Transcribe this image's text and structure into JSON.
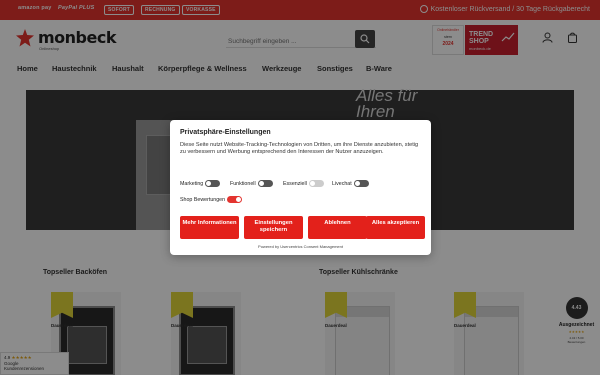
{
  "topbar": {
    "payments": [
      "amazon pay",
      "PayPal PLUS",
      "SOFORT",
      "RECHNUNG",
      "VORKASSE"
    ],
    "shipping_text": "Kostenloser Rückversand / 30 Tage Rückgaberecht"
  },
  "header": {
    "logo_text": "monbeck",
    "logo_tagline": "Onlineshop",
    "search_placeholder": "Suchbegriff eingeben ...",
    "award_line1": "Onlinehändler",
    "award_line2": "stern",
    "award_year": "2024",
    "trend_line1": "TREND",
    "trend_line2": "SHOP",
    "trend_sub": "monbeck.de"
  },
  "nav": {
    "items": [
      "Home",
      "Haustechnik",
      "Haushalt",
      "Körperpflege & Wellness",
      "Werkzeuge",
      "Sonstiges",
      "B-Ware"
    ]
  },
  "hero": {
    "text_line1": "Alles für",
    "text_line2": "Ihren"
  },
  "sections": {
    "left_title": "Topseller Backöfen",
    "right_title": "Topseller Kühlschränke",
    "product_label": "Dauerdeal"
  },
  "trust": {
    "seal": "4.43",
    "title": "Ausgezeichnet",
    "stars": "★★★★★",
    "rating": "4.43 / 5.00",
    "note": "Bewertungen"
  },
  "google": {
    "rating": "4.9",
    "stars": "★★★★★",
    "line1": "Google",
    "line2": "Kundenrezensionen"
  },
  "consent": {
    "title": "Privatsphäre-Einstellungen",
    "text": "Diese Seite nutzt Website-Tracking-Technologien von Dritten, um ihre Dienste anzubieten, stetig zu verbessern und Werbung entsprechend den Interessen der Nutzer anzuzeigen.",
    "toggles": [
      "Marketing",
      "Funktionell",
      "Essenziell",
      "Livechat"
    ],
    "shop_toggle": "Shop Bewertungen",
    "buttons": [
      "Mehr Informationen",
      "Einstellungen speichern",
      "Ablehnen",
      "Alles akzeptieren"
    ],
    "powered": "Powered by Usercentrics Consent Management"
  },
  "colors": {
    "brand_red": "#e3342f",
    "button_red": "#e3211b"
  }
}
